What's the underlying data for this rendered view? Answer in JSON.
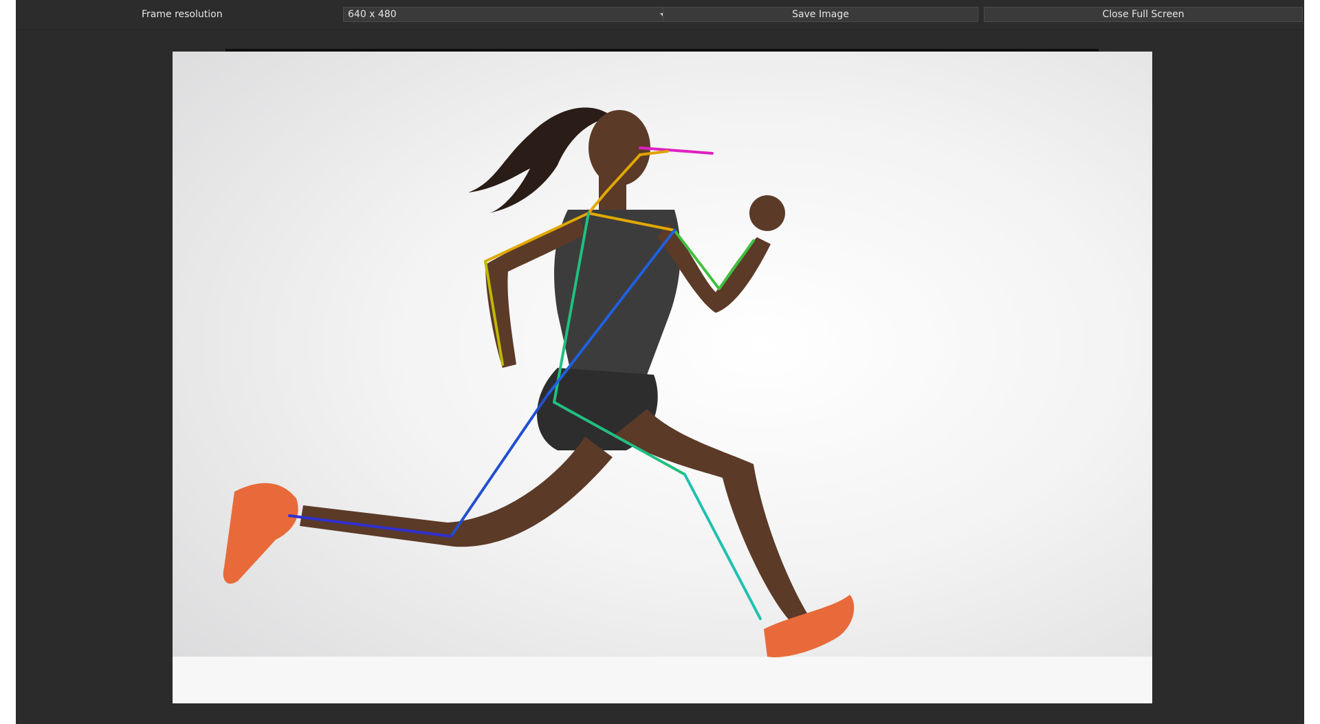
{
  "toolbar": {
    "frame_resolution_label": "Frame resolution",
    "resolution_value": "640 x 480",
    "save_label": "Save Image",
    "close_label": "Close Full Screen"
  },
  "colors": {
    "window_bg": "#2b2b2b",
    "control_bg": "#3a3a3a",
    "text": "#e6e6e6",
    "pose_face": "#e020c0",
    "pose_left_arm": "#e0a800",
    "pose_right_arm": "#40c040",
    "pose_torso_left": "#20c080",
    "pose_torso_right": "#2060e0",
    "pose_left_leg": "#20c0b0",
    "pose_right_leg": "#3030d0",
    "shoe": "#e86a3a"
  },
  "icons": {
    "dropdown": "chevron-down-icon"
  }
}
